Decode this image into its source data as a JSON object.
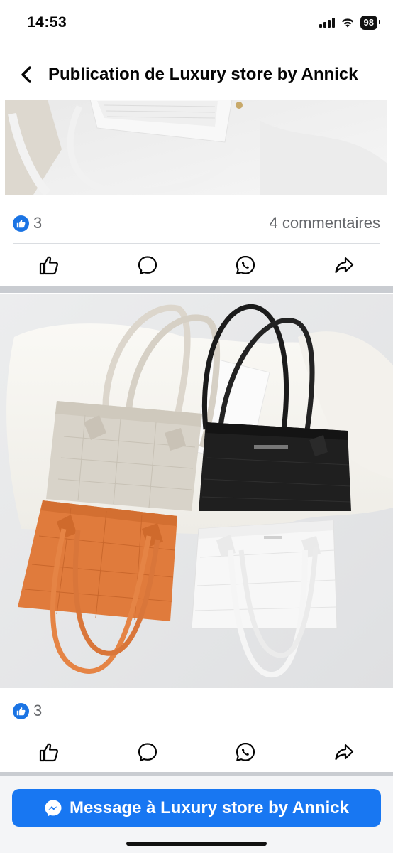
{
  "status_bar": {
    "time": "14:53",
    "battery": "98"
  },
  "header": {
    "title": "Publication de Luxury store by Annick"
  },
  "post1": {
    "reaction_count": "3",
    "comments": "4 commentaires"
  },
  "post2": {
    "reaction_count": "3"
  },
  "bottom": {
    "message_label": "Message à Luxury store by Annick"
  },
  "colors": {
    "accent": "#1877f2",
    "like_badge": "#1b74e4",
    "text_secondary": "#65676b"
  },
  "icons": [
    "back-arrow-icon",
    "signal-icon",
    "wifi-icon",
    "battery-icon",
    "like-icon",
    "comment-icon",
    "whatsapp-icon",
    "share-icon",
    "messenger-icon"
  ]
}
